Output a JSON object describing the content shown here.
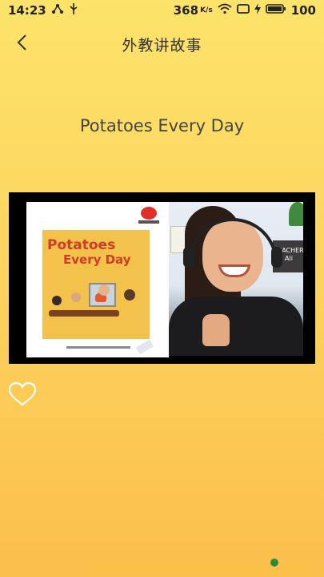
{
  "status_bar": {
    "time": "14:23",
    "network_speed": "368",
    "network_unit": "K/s",
    "battery": "100"
  },
  "header": {
    "title": "外教讲故事"
  },
  "story": {
    "title": "Potatoes Every Day"
  },
  "video": {
    "book_cover": {
      "title_line1": "Potatoes",
      "title_line2": "Every Day"
    },
    "teacher_sign": "TEACHER\nAli"
  },
  "colors": {
    "background_top": "#fde36a",
    "background_bottom": "#fbbf4a",
    "heart_outline": "#ffffff"
  },
  "icons": {
    "back": "chevron-left-icon",
    "like": "heart-outline-icon"
  }
}
